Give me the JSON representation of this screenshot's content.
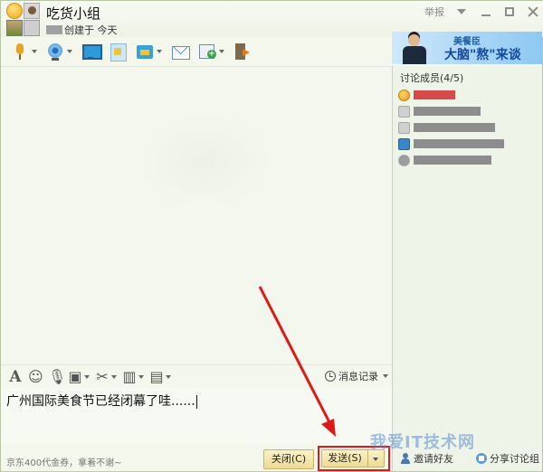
{
  "header": {
    "group_name": "吃货小组",
    "created_text": "创建于 今天",
    "report_label": "举报"
  },
  "ad": {
    "brand": "美餐臣",
    "slogan": "大脑\"熬\"来谈"
  },
  "members": {
    "title": "讨论成员(4/5)"
  },
  "edit_toolbar": {
    "history_label": "消息记录"
  },
  "input": {
    "value": "广州国际美食节已经闭幕了哇......"
  },
  "bottom": {
    "promo": "京东400代金券，拿着不谢~",
    "close_label": "关闭(C)",
    "send_label": "发送(S)"
  },
  "right_bottom": {
    "invite_label": "邀请好友",
    "share_label": "分享讨论组"
  },
  "watermark": "我爱IT技术网",
  "colors": {
    "highlight": "#e01818",
    "button_bg": "#eedb95",
    "panel_bg": "#eff4e8"
  }
}
